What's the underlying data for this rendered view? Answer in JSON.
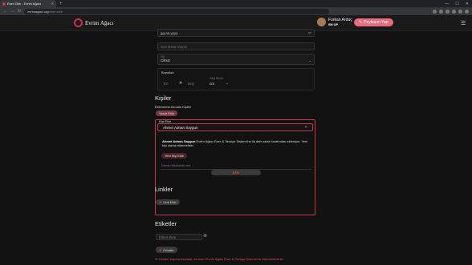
{
  "browser": {
    "tab_title": "Eser Ekle - Evrim Ağacı",
    "url_domain": "evrimagaci.org",
    "url_path": "/eser-ekle"
  },
  "appbar": {
    "logo_text": "Evrim Ağacı",
    "user_name": "Furkan Arduç",
    "user_points": "9M UP",
    "share_label": "Paylaşım Yap"
  },
  "form": {
    "date_placeholder": "gg.aa.yyyy",
    "page_count_placeholder": "Son Basıt Sayısı",
    "cilt_label": "Cilt",
    "cilt_value": "Ciltsiz",
    "dimensions_label": "Boyutları",
    "width_placeholder": "En",
    "height_placeholder": "Boy",
    "unit_label": "Ölçü Birimi",
    "unit_value": "cm",
    "persons_title": "Kişiler",
    "persons_sub": "Eklenmesi Zorunlu Kişiler",
    "author_pill": "Yazar Ekle",
    "person_add_label": "Kişi Ekle",
    "person_search_value": "Ahmet Adnan Saygun",
    "result_name": "Ahmet Adnan Saygun",
    "result_text": "Evrim Ağacı Eser & Tavsiye Sistemi'ne ilk defa senin tarafından ekleniyor. Yeni kişi olarak eklemelisin.",
    "new_person_btn": "Yeni Kişi Ekle",
    "role_placeholder": "Ünvan listesinde ara",
    "add_btn": "Ekle",
    "links_title": "Linkler",
    "link_pill": "Link Ekle",
    "tags_title": "Etiketler",
    "tag_placeholder": "Etiket Ekle",
    "submit_label": "Gönder",
    "warning_text": "Gönder tuşuna basarak, bu eseri Evrim Ağacı Eser & Tavsiye Sistemi'ne eklemektesiniz."
  }
}
